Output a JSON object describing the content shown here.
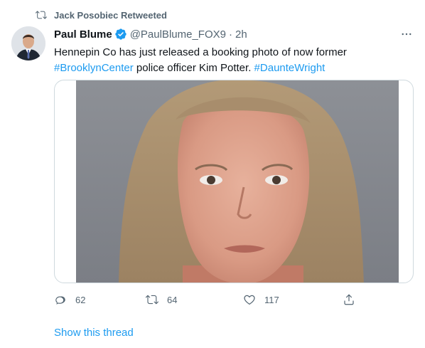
{
  "retweet": {
    "icon": "retweet-icon",
    "label": "Jack Posobiec Retweeted"
  },
  "tweet": {
    "author": {
      "display_name": "Paul Blume",
      "verified": true,
      "handle": "@PaulBlume_FOX9",
      "separator": "·",
      "time": "2h"
    },
    "text": {
      "line1": "Hennepin Co has just released a booking photo of now former",
      "hashtag1": "#BrooklynCenter",
      "middle": " police officer Kim Potter. ",
      "hashtag2": "#DaunteWright"
    },
    "media": {
      "type": "photo"
    },
    "actions": {
      "reply": {
        "icon": "reply-icon",
        "count": "62"
      },
      "retweet": {
        "icon": "retweet-icon",
        "count": "64"
      },
      "like": {
        "icon": "heart-icon",
        "count": "117"
      },
      "share": {
        "icon": "share-icon"
      }
    },
    "show_thread": "Show this thread"
  },
  "colors": {
    "accent": "#1d9bf0",
    "secondary_text": "#536471",
    "border": "#cfd9de"
  }
}
